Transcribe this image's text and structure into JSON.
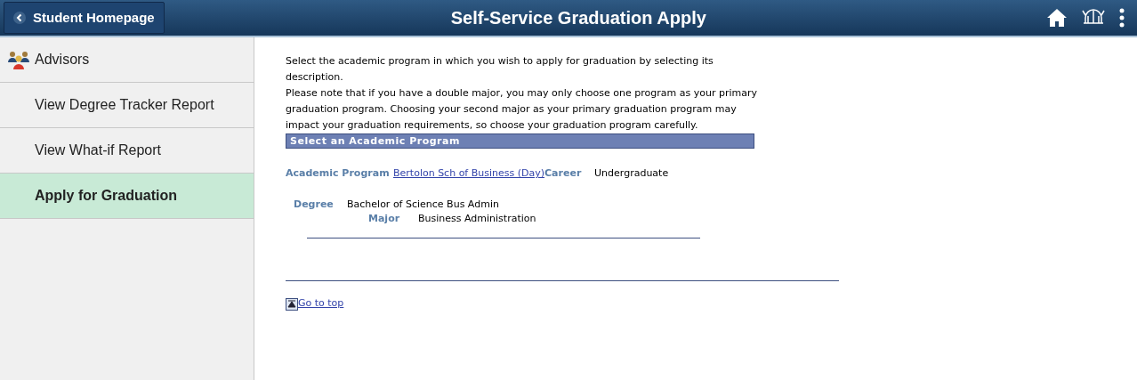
{
  "header": {
    "back_button": "Student Homepage",
    "title": "Self-Service Graduation Apply"
  },
  "sidebar": {
    "items": [
      {
        "label": "Advisors",
        "kind": "heading",
        "selected": false
      },
      {
        "label": "View Degree Tracker Report",
        "kind": "link",
        "selected": false
      },
      {
        "label": "View What-if Report",
        "kind": "link",
        "selected": false
      },
      {
        "label": "Apply for Graduation",
        "kind": "link",
        "selected": true
      }
    ]
  },
  "instructions": [
    "Select the academic program in which you wish to apply for graduation by selecting its description.",
    "Please note that if you have a double major, you may only choose one program as your primary graduation program. Choosing your second major as your primary graduation program may impact your graduation requirements, so choose your graduation program carefully."
  ],
  "section_title": "Select an Academic Program",
  "program": {
    "academic_program_label": "Academic Program",
    "academic_program": "Bertolon Sch of Business (Day)",
    "career_label": "Career",
    "career": "Undergraduate",
    "degree_label": "Degree",
    "degree": "Bachelor of Science Bus Admin",
    "major_label": "Major",
    "major": "Business Administration"
  },
  "go_to_top": "Go to top"
}
